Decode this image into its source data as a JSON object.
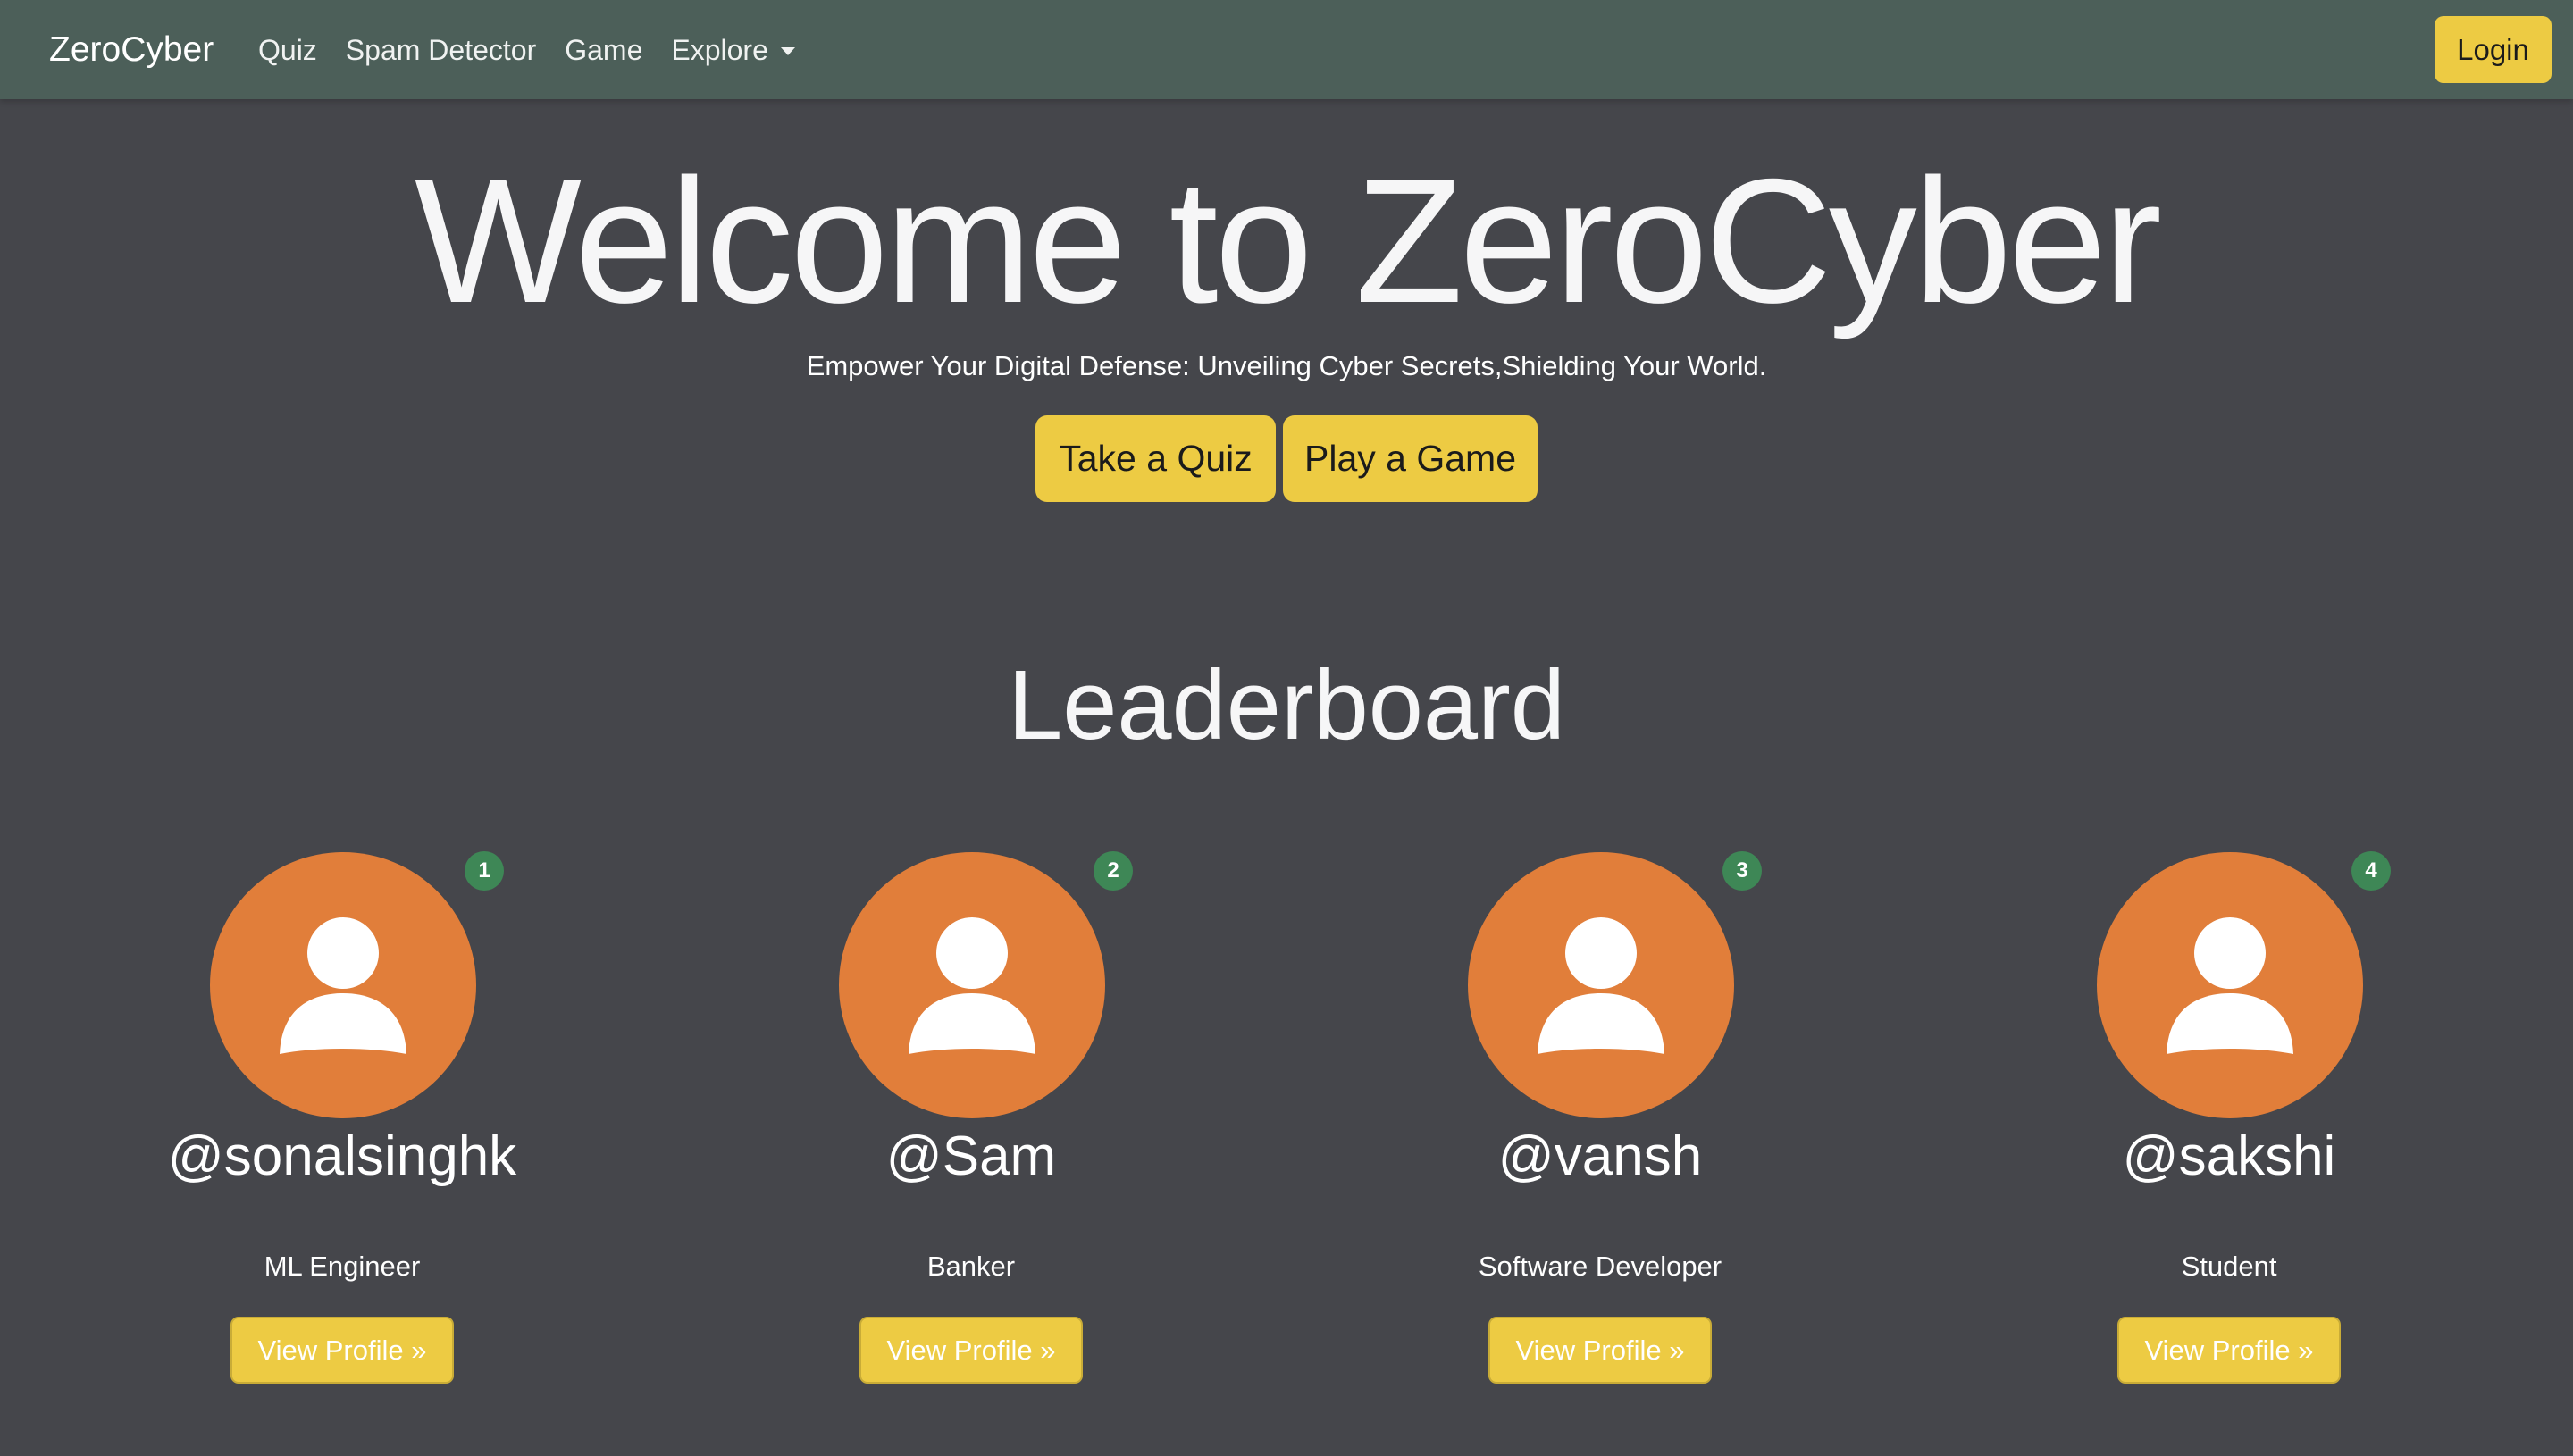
{
  "colors": {
    "navbar_bg": "#4c5f59",
    "page_bg": "#45464b",
    "accent_yellow": "#edcb43",
    "avatar_orange": "#e17e3a",
    "badge_green": "#3e8756"
  },
  "nav": {
    "brand": "ZeroCyber",
    "links": [
      {
        "label": "Quiz"
      },
      {
        "label": "Spam Detector"
      },
      {
        "label": "Game"
      },
      {
        "label": "Explore",
        "icon": "caret-down-icon"
      }
    ],
    "login_label": "Login"
  },
  "hero": {
    "title": "Welcome to ZeroCyber",
    "subtitle": "Empower Your Digital Defense: Unveiling Cyber Secrets,Shielding Your World.",
    "quiz_button": "Take a Quiz",
    "game_button": "Play a Game"
  },
  "leaderboard": {
    "title": "Leaderboard",
    "entries": [
      {
        "rank": "1",
        "username": "@sonalsinghk",
        "role": "ML Engineer",
        "button": "View Profile »",
        "icon": "user-avatar-icon"
      },
      {
        "rank": "2",
        "username": "@Sam",
        "role": "Banker",
        "button": "View Profile »",
        "icon": "user-avatar-icon"
      },
      {
        "rank": "3",
        "username": "@vansh",
        "role": "Software Developer",
        "button": "View Profile »",
        "icon": "user-avatar-icon"
      },
      {
        "rank": "4",
        "username": "@sakshi",
        "role": "Student",
        "button": "View Profile »",
        "icon": "user-avatar-icon"
      }
    ]
  }
}
